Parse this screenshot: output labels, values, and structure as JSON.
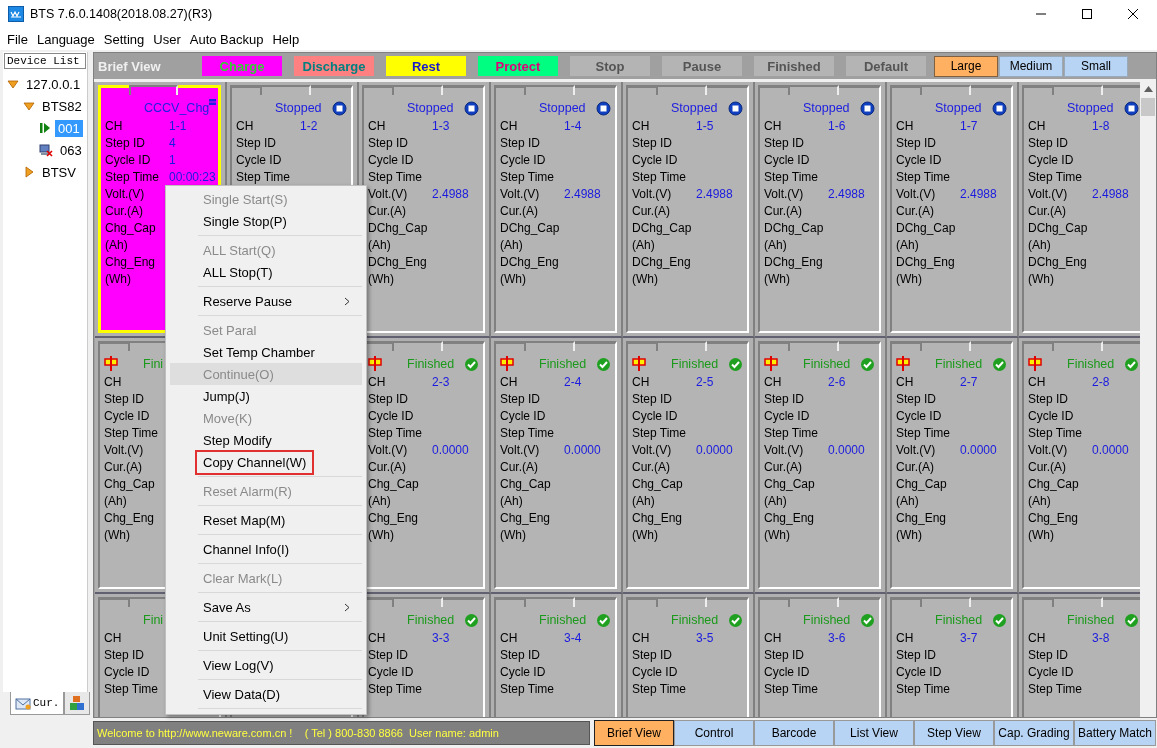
{
  "window": {
    "title": "BTS 7.6.0.1408(2018.08.27)(R3)"
  },
  "menu_bar": [
    "File",
    "Language",
    "Setting",
    "User",
    "Auto Backup",
    "Help"
  ],
  "sidebar": {
    "title": "Device List",
    "tree": [
      {
        "label": "127.0.0.1",
        "kind": "folder",
        "expanded": true,
        "selected": false,
        "children": [
          {
            "label": "BTS82",
            "kind": "folder",
            "expanded": true,
            "selected": false,
            "children": [
              {
                "label": "001",
                "kind": "running",
                "selected": true
              },
              {
                "label": "063",
                "kind": "offline",
                "selected": false
              }
            ]
          },
          {
            "label": "BTSV",
            "kind": "folder",
            "expanded": false,
            "selected": false
          }
        ]
      }
    ],
    "tabs": [
      {
        "label": "Cur.",
        "kind": "mail",
        "selected": true
      },
      {
        "kind": "blocks",
        "selected": false
      }
    ]
  },
  "legend": {
    "title": "Brief View",
    "items": [
      {
        "label": "Charge",
        "color": "#ff00ff",
        "kind": "charge"
      },
      {
        "label": "Discharge",
        "color": "#ff8080",
        "kind": "discharge"
      },
      {
        "label": "Rest",
        "color": "#ffff00",
        "kind": "rest"
      },
      {
        "label": "Protect",
        "color": "#00ff80",
        "kind": "protect"
      },
      {
        "label": "Stop",
        "color": "#b4b4b4",
        "kind": "idle"
      },
      {
        "label": "Pause",
        "color": "#b4b4b4",
        "kind": "idle"
      },
      {
        "label": "Finished",
        "color": "#b4b4b4",
        "kind": "idle"
      },
      {
        "label": "Default",
        "color": "#b4b4b4",
        "kind": "idle"
      }
    ],
    "sizes": [
      {
        "label": "Large",
        "selected": true
      },
      {
        "label": "Medium",
        "selected": false
      },
      {
        "label": "Small",
        "selected": false
      }
    ]
  },
  "channel_rows": [
    {
      "cards": [
        {
          "kind": "charge",
          "selected": true,
          "status": "CCCV_Chg",
          "fields": [
            {
              "label": "CH",
              "value": "1-1"
            },
            {
              "label": "Step ID",
              "value": "4"
            },
            {
              "label": "Cycle ID",
              "value": "1"
            },
            {
              "label": "Step Time",
              "value": "00:00:23"
            },
            {
              "label": "Volt.(V)"
            },
            {
              "label": "Cur.(A)"
            },
            {
              "label": "Chg_Cap (Ah)"
            },
            {
              "label": "Chg_Eng (Wh)"
            }
          ]
        },
        {
          "kind": "stopped",
          "selected": false,
          "status": "Stopped",
          "fields": [
            {
              "label": "CH",
              "value": "1-2"
            },
            {
              "label": "Step ID"
            },
            {
              "label": "Cycle ID"
            },
            {
              "label": "Step Time"
            }
          ]
        },
        {
          "kind": "stopped",
          "selected": false,
          "status": "Stopped",
          "fields": [
            {
              "label": "CH",
              "value": "1-3"
            },
            {
              "label": "Step ID"
            },
            {
              "label": "Cycle ID"
            },
            {
              "label": "Step Time"
            },
            {
              "label": "Volt.(V)",
              "value": "2.4988"
            },
            {
              "label": "Cur.(A)"
            },
            {
              "label": "DChg_Cap (Ah)"
            },
            {
              "label": "DChg_Eng (Wh)"
            }
          ]
        },
        {
          "kind": "stopped",
          "selected": false,
          "status": "Stopped",
          "fields": [
            {
              "label": "CH",
              "value": "1-4"
            },
            {
              "label": "Step ID"
            },
            {
              "label": "Cycle ID"
            },
            {
              "label": "Step Time"
            },
            {
              "label": "Volt.(V)",
              "value": "2.4988"
            },
            {
              "label": "Cur.(A)"
            },
            {
              "label": "DChg_Cap (Ah)"
            },
            {
              "label": "DChg_Eng (Wh)"
            }
          ]
        },
        {
          "kind": "stopped",
          "selected": false,
          "status": "Stopped",
          "fields": [
            {
              "label": "CH",
              "value": "1-5"
            },
            {
              "label": "Step ID"
            },
            {
              "label": "Cycle ID"
            },
            {
              "label": "Step Time"
            },
            {
              "label": "Volt.(V)",
              "value": "2.4988"
            },
            {
              "label": "Cur.(A)"
            },
            {
              "label": "DChg_Cap (Ah)"
            },
            {
              "label": "DChg_Eng (Wh)"
            }
          ]
        },
        {
          "kind": "stopped",
          "selected": false,
          "status": "Stopped",
          "fields": [
            {
              "label": "CH",
              "value": "1-6"
            },
            {
              "label": "Step ID"
            },
            {
              "label": "Cycle ID"
            },
            {
              "label": "Step Time"
            },
            {
              "label": "Volt.(V)",
              "value": "2.4988"
            },
            {
              "label": "Cur.(A)"
            },
            {
              "label": "DChg_Cap (Ah)"
            },
            {
              "label": "DChg_Eng (Wh)"
            }
          ]
        },
        {
          "kind": "stopped",
          "selected": false,
          "status": "Stopped",
          "fields": [
            {
              "label": "CH",
              "value": "1-7"
            },
            {
              "label": "Step ID"
            },
            {
              "label": "Cycle ID"
            },
            {
              "label": "Step Time"
            },
            {
              "label": "Volt.(V)",
              "value": "2.4988"
            },
            {
              "label": "Cur.(A)"
            },
            {
              "label": "DChg_Cap (Ah)"
            },
            {
              "label": "DChg_Eng (Wh)"
            }
          ]
        },
        {
          "kind": "stopped",
          "selected": false,
          "status": "Stopped",
          "fields": [
            {
              "label": "CH",
              "value": "1-8"
            },
            {
              "label": "Step ID"
            },
            {
              "label": "Cycle ID"
            },
            {
              "label": "Step Time"
            },
            {
              "label": "Volt.(V)",
              "value": "2.4988"
            },
            {
              "label": "Cur.(A)"
            },
            {
              "label": "DChg_Cap (Ah)"
            },
            {
              "label": "DChg_Eng (Wh)"
            }
          ]
        }
      ]
    },
    {
      "cards": [
        {
          "kind": "finished",
          "selected": false,
          "alarm": true,
          "status": "Fini",
          "fields": [
            {
              "label": "CH"
            },
            {
              "label": "Step ID"
            },
            {
              "label": "Cycle ID"
            },
            {
              "label": "Step Time"
            },
            {
              "label": "Volt.(V)"
            },
            {
              "label": "Cur.(A)"
            },
            {
              "label": "Chg_Cap (Ah)"
            },
            {
              "label": "Chg_Eng (Wh)"
            }
          ]
        },
        {
          "kind": "covered"
        },
        {
          "kind": "finished",
          "selected": false,
          "alarm": true,
          "status": "Finished",
          "fields": [
            {
              "label": "CH",
              "value": "2-3"
            },
            {
              "label": "Step ID"
            },
            {
              "label": "Cycle ID"
            },
            {
              "label": "Step Time"
            },
            {
              "label": "Volt.(V)",
              "value": "0.0000"
            },
            {
              "label": "Cur.(A)"
            },
            {
              "label": "Chg_Cap (Ah)"
            },
            {
              "label": "Chg_Eng (Wh)"
            }
          ]
        },
        {
          "kind": "finished",
          "selected": false,
          "alarm": true,
          "status": "Finished",
          "fields": [
            {
              "label": "CH",
              "value": "2-4"
            },
            {
              "label": "Step ID"
            },
            {
              "label": "Cycle ID"
            },
            {
              "label": "Step Time"
            },
            {
              "label": "Volt.(V)",
              "value": "0.0000"
            },
            {
              "label": "Cur.(A)"
            },
            {
              "label": "Chg_Cap (Ah)"
            },
            {
              "label": "Chg_Eng (Wh)"
            }
          ]
        },
        {
          "kind": "finished",
          "selected": false,
          "alarm": true,
          "status": "Finished",
          "fields": [
            {
              "label": "CH",
              "value": "2-5"
            },
            {
              "label": "Step ID"
            },
            {
              "label": "Cycle ID"
            },
            {
              "label": "Step Time"
            },
            {
              "label": "Volt.(V)",
              "value": "0.0000"
            },
            {
              "label": "Cur.(A)"
            },
            {
              "label": "Chg_Cap (Ah)"
            },
            {
              "label": "Chg_Eng (Wh)"
            }
          ]
        },
        {
          "kind": "finished",
          "selected": false,
          "alarm": true,
          "status": "Finished",
          "fields": [
            {
              "label": "CH",
              "value": "2-6"
            },
            {
              "label": "Step ID"
            },
            {
              "label": "Cycle ID"
            },
            {
              "label": "Step Time"
            },
            {
              "label": "Volt.(V)",
              "value": "0.0000"
            },
            {
              "label": "Cur.(A)"
            },
            {
              "label": "Chg_Cap (Ah)"
            },
            {
              "label": "Chg_Eng (Wh)"
            }
          ]
        },
        {
          "kind": "finished",
          "selected": false,
          "alarm": true,
          "status": "Finished",
          "fields": [
            {
              "label": "CH",
              "value": "2-7"
            },
            {
              "label": "Step ID"
            },
            {
              "label": "Cycle ID"
            },
            {
              "label": "Step Time"
            },
            {
              "label": "Volt.(V)",
              "value": "0.0000"
            },
            {
              "label": "Cur.(A)"
            },
            {
              "label": "Chg_Cap (Ah)"
            },
            {
              "label": "Chg_Eng (Wh)"
            }
          ]
        },
        {
          "kind": "finished",
          "selected": false,
          "alarm": true,
          "status": "Finished",
          "fields": [
            {
              "label": "CH",
              "value": "2-8"
            },
            {
              "label": "Step ID"
            },
            {
              "label": "Cycle ID"
            },
            {
              "label": "Step Time"
            },
            {
              "label": "Volt.(V)",
              "value": "0.0000"
            },
            {
              "label": "Cur.(A)"
            },
            {
              "label": "Chg_Cap (Ah)"
            },
            {
              "label": "Chg_Eng (Wh)"
            }
          ]
        }
      ]
    },
    {
      "cards": [
        {
          "kind": "finished",
          "selected": false,
          "status": "Fini",
          "fields": [
            {
              "label": "CH"
            },
            {
              "label": "Step ID"
            },
            {
              "label": "Cycle ID"
            },
            {
              "label": "Step Time"
            }
          ]
        },
        {
          "kind": "covered"
        },
        {
          "kind": "finished",
          "selected": false,
          "status": "Finished",
          "fields": [
            {
              "label": "CH",
              "value": "3-3"
            },
            {
              "label": "Step ID"
            },
            {
              "label": "Cycle ID"
            },
            {
              "label": "Step Time"
            }
          ]
        },
        {
          "kind": "finished",
          "selected": false,
          "status": "Finished",
          "fields": [
            {
              "label": "CH",
              "value": "3-4"
            },
            {
              "label": "Step ID"
            },
            {
              "label": "Cycle ID"
            },
            {
              "label": "Step Time"
            }
          ]
        },
        {
          "kind": "finished",
          "selected": false,
          "status": "Finished",
          "fields": [
            {
              "label": "CH",
              "value": "3-5"
            },
            {
              "label": "Step ID"
            },
            {
              "label": "Cycle ID"
            },
            {
              "label": "Step Time"
            }
          ]
        },
        {
          "kind": "finished",
          "selected": false,
          "status": "Finished",
          "fields": [
            {
              "label": "CH",
              "value": "3-6"
            },
            {
              "label": "Step ID"
            },
            {
              "label": "Cycle ID"
            },
            {
              "label": "Step Time"
            }
          ]
        },
        {
          "kind": "finished",
          "selected": false,
          "status": "Finished",
          "fields": [
            {
              "label": "CH",
              "value": "3-7"
            },
            {
              "label": "Step ID"
            },
            {
              "label": "Cycle ID"
            },
            {
              "label": "Step Time"
            }
          ]
        },
        {
          "kind": "finished",
          "selected": false,
          "status": "Finished",
          "fields": [
            {
              "label": "CH",
              "value": "3-8"
            },
            {
              "label": "Step ID"
            },
            {
              "label": "Cycle ID"
            },
            {
              "label": "Step Time"
            }
          ]
        }
      ]
    }
  ],
  "context_menu": [
    {
      "label": "Single Start(S)",
      "disabled": true,
      "highlighted": false,
      "marked": false,
      "submenu": false,
      "separator": false
    },
    {
      "label": "Single Stop(P)",
      "disabled": false,
      "highlighted": false,
      "marked": false,
      "submenu": false,
      "separator": true
    },
    {
      "label": "ALL Start(Q)",
      "disabled": true,
      "highlighted": false,
      "marked": false,
      "submenu": false,
      "separator": false
    },
    {
      "label": "ALL Stop(T)",
      "disabled": false,
      "highlighted": false,
      "marked": false,
      "submenu": false,
      "separator": true
    },
    {
      "label": "Reserve Pause",
      "disabled": false,
      "highlighted": false,
      "marked": false,
      "submenu": true,
      "separator": true
    },
    {
      "label": "Set Paral",
      "disabled": true,
      "highlighted": false,
      "marked": false,
      "submenu": false,
      "separator": false
    },
    {
      "label": "Set Temp Chamber",
      "disabled": false,
      "highlighted": false,
      "marked": false,
      "submenu": false,
      "separator": false
    },
    {
      "label": "Continue(O)",
      "disabled": true,
      "highlighted": true,
      "marked": false,
      "submenu": false,
      "separator": false
    },
    {
      "label": "Jump(J)",
      "disabled": false,
      "highlighted": false,
      "marked": false,
      "submenu": false,
      "separator": false
    },
    {
      "label": "Move(K)",
      "disabled": true,
      "highlighted": false,
      "marked": false,
      "submenu": false,
      "separator": false
    },
    {
      "label": "Step Modify",
      "disabled": false,
      "highlighted": false,
      "marked": false,
      "submenu": false,
      "separator": false
    },
    {
      "label": "Copy Channel(W)",
      "disabled": false,
      "highlighted": false,
      "marked": true,
      "submenu": false,
      "separator": true
    },
    {
      "label": "Reset Alarm(R)",
      "disabled": true,
      "highlighted": false,
      "marked": false,
      "submenu": false,
      "separator": true
    },
    {
      "label": "Reset Map(M)",
      "disabled": false,
      "highlighted": false,
      "marked": false,
      "submenu": false,
      "separator": true
    },
    {
      "label": "Channel Info(I)",
      "disabled": false,
      "highlighted": false,
      "marked": false,
      "submenu": false,
      "separator": true
    },
    {
      "label": "Clear Mark(L)",
      "disabled": true,
      "highlighted": false,
      "marked": false,
      "submenu": false,
      "separator": true
    },
    {
      "label": "Save As",
      "disabled": false,
      "highlighted": false,
      "marked": false,
      "submenu": true,
      "separator": true
    },
    {
      "label": "Unit Setting(U)",
      "disabled": false,
      "highlighted": false,
      "marked": false,
      "submenu": false,
      "separator": true
    },
    {
      "label": "View Log(V)",
      "disabled": false,
      "highlighted": false,
      "marked": false,
      "submenu": false,
      "separator": true
    },
    {
      "label": "View Data(D)",
      "disabled": false,
      "highlighted": false,
      "marked": false,
      "submenu": false,
      "separator": true
    }
  ],
  "status_bar": {
    "message": "Welcome to http://www.neware.com.cn !    ( Tel ) 800-830 8866  User name: admin"
  },
  "view_tabs": [
    {
      "label": "Brief View",
      "selected": true
    },
    {
      "label": "Control",
      "selected": false
    },
    {
      "label": "Barcode",
      "selected": false
    },
    {
      "label": "List View",
      "selected": false
    },
    {
      "label": "Step View",
      "selected": false
    },
    {
      "label": "Cap. Grading",
      "selected": false
    },
    {
      "label": "Battery Match",
      "selected": false
    }
  ]
}
